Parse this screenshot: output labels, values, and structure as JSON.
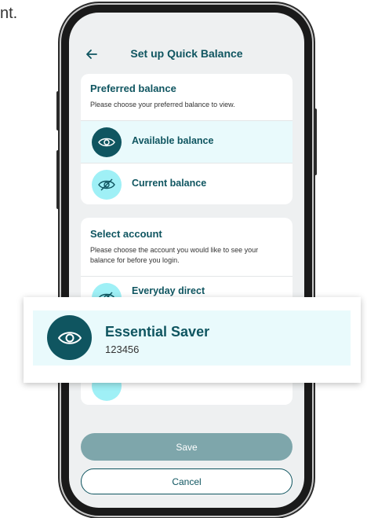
{
  "corner_text": "nt.",
  "header": {
    "title": "Set up Quick Balance",
    "back_icon": "arrow-left-icon"
  },
  "preferred_balance": {
    "heading": "Preferred balance",
    "subtitle": "Please choose your preferred balance to view.",
    "options": [
      {
        "label": "Available balance",
        "icon": "eye-icon",
        "selected": true
      },
      {
        "label": "Current balance",
        "icon": "eye-off-icon",
        "selected": false
      }
    ]
  },
  "select_account": {
    "heading": "Select account",
    "subtitle": "Please choose the account you would like to see your balance for before you login.",
    "accounts": [
      {
        "name": "Everyday direct",
        "number": "123456",
        "icon": "eye-off-icon"
      }
    ]
  },
  "zoom_callout": {
    "name": "Essential Saver",
    "number": "123456",
    "icon": "eye-icon"
  },
  "buttons": {
    "save": "Save",
    "cancel": "Cancel"
  },
  "colors": {
    "primary": "#0f5560",
    "selected_bg": "#e9fafc",
    "icon_light": "#9ff0f6",
    "save_disabled": "#7ea6ab"
  }
}
